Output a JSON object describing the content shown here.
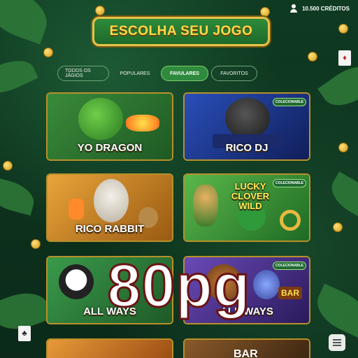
{
  "header": {
    "credits": "10.500 CRÉDITOS",
    "user_icon": "user-icon"
  },
  "title": "ESCOLHA SEU JOGO",
  "tabs": [
    {
      "label": "TODOS OS JÁGIOS",
      "active": false
    },
    {
      "label": "POPULARES",
      "active": false
    },
    {
      "label": "FAVULARES",
      "active": true
    },
    {
      "label": "FAVORITOS",
      "active": false
    }
  ],
  "games": [
    {
      "title": "YO DRAGON",
      "badge": ""
    },
    {
      "title": "RICO DJ",
      "badge": "COLECIONABLE"
    },
    {
      "title": "RICO RABBIT",
      "badge": ""
    },
    {
      "title": "LUCKY CLOVER WILD",
      "line1": "LUCKY",
      "line2": "CLOVER",
      "line3": "WILD",
      "badge": "COLECIONABLE"
    },
    {
      "title": "ALL WAYS",
      "badge": ""
    },
    {
      "title": "ALL WAYS",
      "badge": "COLECIONABLE",
      "extra": "BAR"
    },
    {
      "title": "",
      "badge": ""
    },
    {
      "title": "BAR",
      "badge": ""
    }
  ],
  "overlay": "80pg",
  "colors": {
    "accent": "#2f8a3d",
    "gold": "#e6c34a",
    "background": "#0f3a22"
  }
}
